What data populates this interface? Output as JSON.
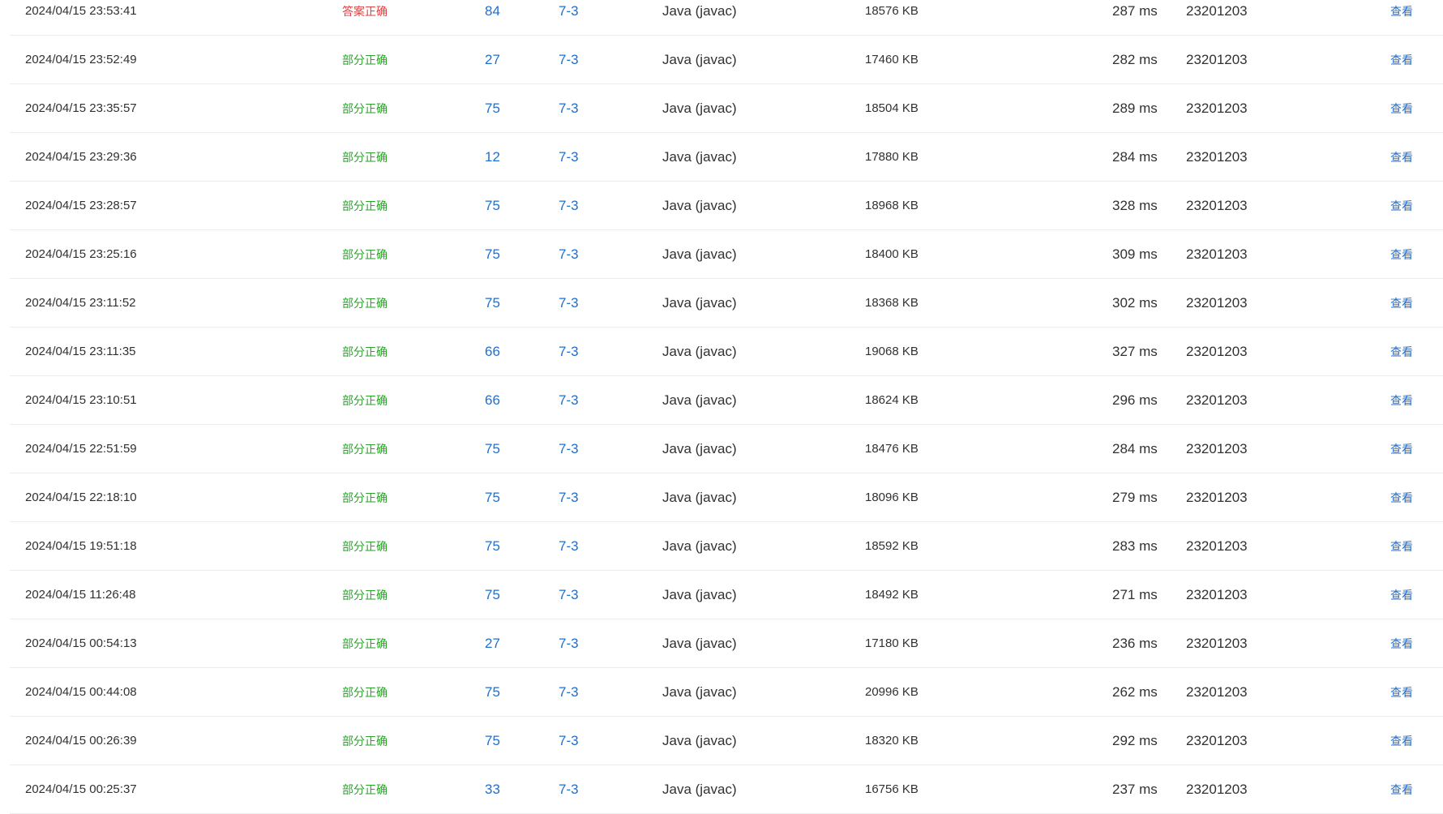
{
  "colors": {
    "accepted": "#e03f3f",
    "partial": "#2aa52a",
    "link": "#1f6fd1",
    "text": "#303133",
    "divider": "#ececec"
  },
  "rows": [
    {
      "time": "2024/04/15 23:53:41",
      "status": "答案正确",
      "status_type": "ok",
      "score": "84",
      "problem": "7-3",
      "language": "Java (javac)",
      "memory": "18576 KB",
      "runtime": "287 ms",
      "user": "23201203",
      "action": "查看"
    },
    {
      "time": "2024/04/15 23:52:49",
      "status": "部分正确",
      "status_type": "part",
      "score": "27",
      "problem": "7-3",
      "language": "Java (javac)",
      "memory": "17460 KB",
      "runtime": "282 ms",
      "user": "23201203",
      "action": "查看"
    },
    {
      "time": "2024/04/15 23:35:57",
      "status": "部分正确",
      "status_type": "part",
      "score": "75",
      "problem": "7-3",
      "language": "Java (javac)",
      "memory": "18504 KB",
      "runtime": "289 ms",
      "user": "23201203",
      "action": "查看"
    },
    {
      "time": "2024/04/15 23:29:36",
      "status": "部分正确",
      "status_type": "part",
      "score": "12",
      "problem": "7-3",
      "language": "Java (javac)",
      "memory": "17880 KB",
      "runtime": "284 ms",
      "user": "23201203",
      "action": "查看"
    },
    {
      "time": "2024/04/15 23:28:57",
      "status": "部分正确",
      "status_type": "part",
      "score": "75",
      "problem": "7-3",
      "language": "Java (javac)",
      "memory": "18968 KB",
      "runtime": "328 ms",
      "user": "23201203",
      "action": "查看"
    },
    {
      "time": "2024/04/15 23:25:16",
      "status": "部分正确",
      "status_type": "part",
      "score": "75",
      "problem": "7-3",
      "language": "Java (javac)",
      "memory": "18400 KB",
      "runtime": "309 ms",
      "user": "23201203",
      "action": "查看"
    },
    {
      "time": "2024/04/15 23:11:52",
      "status": "部分正确",
      "status_type": "part",
      "score": "75",
      "problem": "7-3",
      "language": "Java (javac)",
      "memory": "18368 KB",
      "runtime": "302 ms",
      "user": "23201203",
      "action": "查看"
    },
    {
      "time": "2024/04/15 23:11:35",
      "status": "部分正确",
      "status_type": "part",
      "score": "66",
      "problem": "7-3",
      "language": "Java (javac)",
      "memory": "19068 KB",
      "runtime": "327 ms",
      "user": "23201203",
      "action": "查看"
    },
    {
      "time": "2024/04/15 23:10:51",
      "status": "部分正确",
      "status_type": "part",
      "score": "66",
      "problem": "7-3",
      "language": "Java (javac)",
      "memory": "18624 KB",
      "runtime": "296 ms",
      "user": "23201203",
      "action": "查看"
    },
    {
      "time": "2024/04/15 22:51:59",
      "status": "部分正确",
      "status_type": "part",
      "score": "75",
      "problem": "7-3",
      "language": "Java (javac)",
      "memory": "18476 KB",
      "runtime": "284 ms",
      "user": "23201203",
      "action": "查看"
    },
    {
      "time": "2024/04/15 22:18:10",
      "status": "部分正确",
      "status_type": "part",
      "score": "75",
      "problem": "7-3",
      "language": "Java (javac)",
      "memory": "18096 KB",
      "runtime": "279 ms",
      "user": "23201203",
      "action": "查看"
    },
    {
      "time": "2024/04/15 19:51:18",
      "status": "部分正确",
      "status_type": "part",
      "score": "75",
      "problem": "7-3",
      "language": "Java (javac)",
      "memory": "18592 KB",
      "runtime": "283 ms",
      "user": "23201203",
      "action": "查看"
    },
    {
      "time": "2024/04/15 11:26:48",
      "status": "部分正确",
      "status_type": "part",
      "score": "75",
      "problem": "7-3",
      "language": "Java (javac)",
      "memory": "18492 KB",
      "runtime": "271 ms",
      "user": "23201203",
      "action": "查看"
    },
    {
      "time": "2024/04/15 00:54:13",
      "status": "部分正确",
      "status_type": "part",
      "score": "27",
      "problem": "7-3",
      "language": "Java (javac)",
      "memory": "17180 KB",
      "runtime": "236 ms",
      "user": "23201203",
      "action": "查看"
    },
    {
      "time": "2024/04/15 00:44:08",
      "status": "部分正确",
      "status_type": "part",
      "score": "75",
      "problem": "7-3",
      "language": "Java (javac)",
      "memory": "20996 KB",
      "runtime": "262 ms",
      "user": "23201203",
      "action": "查看"
    },
    {
      "time": "2024/04/15 00:26:39",
      "status": "部分正确",
      "status_type": "part",
      "score": "75",
      "problem": "7-3",
      "language": "Java (javac)",
      "memory": "18320 KB",
      "runtime": "292 ms",
      "user": "23201203",
      "action": "查看"
    },
    {
      "time": "2024/04/15 00:25:37",
      "status": "部分正确",
      "status_type": "part",
      "score": "33",
      "problem": "7-3",
      "language": "Java (javac)",
      "memory": "16756 KB",
      "runtime": "237 ms",
      "user": "23201203",
      "action": "查看"
    }
  ]
}
